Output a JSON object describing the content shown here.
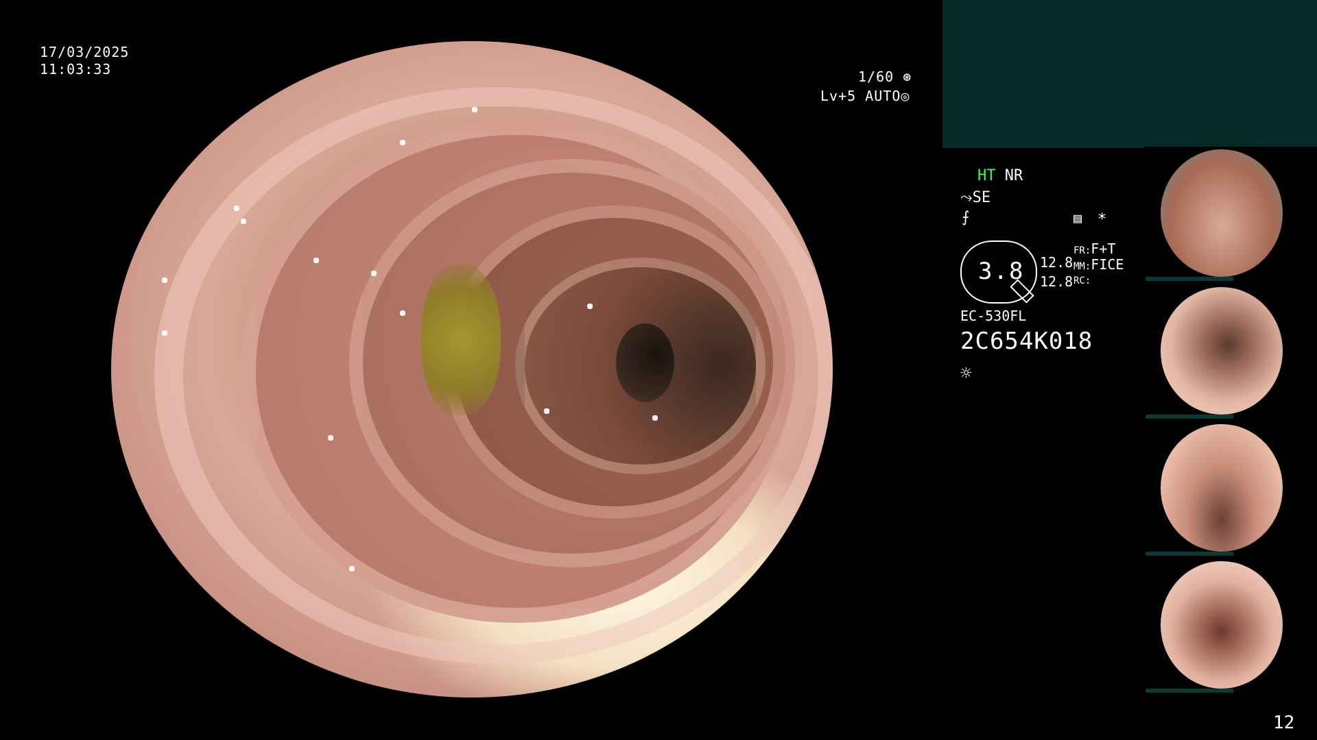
{
  "overlay": {
    "date": "17/03/2025",
    "time": "11:03:33",
    "shutter": "1/60",
    "level": "Lv+5",
    "auto": "AUTO"
  },
  "settings": {
    "ht": "HT",
    "nr": "NR",
    "se": "SE",
    "star": "*",
    "value_big": "3.8",
    "value_a": "12.8",
    "value_b": "12.8",
    "fr_label": "FR:",
    "fr_value": "F+T",
    "mm_label": "MM:",
    "mm_value": "FICE",
    "rc_label": "RC:",
    "scope_model": "EC-530FL",
    "serial": "2C654K018"
  },
  "thumbnails": [
    {
      "label": "thumbnail-1"
    },
    {
      "label": "thumbnail-2"
    },
    {
      "label": "thumbnail-3"
    },
    {
      "label": "thumbnail-4"
    }
  ],
  "page_number": "12",
  "icons": {
    "shutter": "aperture-icon",
    "auto": "iris-icon",
    "se": "structure-enhance-icon",
    "f": "f-icon",
    "memo": "memo-icon",
    "light": "light-icon"
  }
}
